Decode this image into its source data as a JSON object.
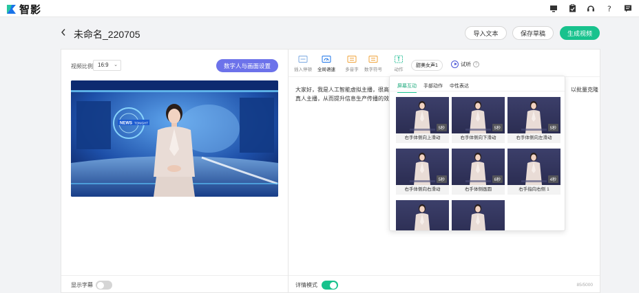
{
  "app": {
    "name": "智影"
  },
  "header": {
    "title": "未命名_220705",
    "import_label": "导入文本",
    "save_label": "保存草稿",
    "generate_label": "生成视频"
  },
  "left_panel": {
    "ratio_label": "视频比例",
    "ratio_value": "16:9",
    "avatar_settings_label": "数字人与画面设置",
    "preview_badge_main": "NEWS",
    "preview_badge_sub": "TONIGHT",
    "subtitle_label": "显示字幕",
    "subtitle_enabled": false
  },
  "toolbar": {
    "items": [
      {
        "label": "插入停顿"
      },
      {
        "label": "全局语速"
      },
      {
        "label": "多音字"
      },
      {
        "label": "数字符号"
      },
      {
        "label": "动作"
      }
    ],
    "voice_label": "甜美女声1",
    "listen_label": "试听",
    "help_icon": "?"
  },
  "script": {
    "line1_start": "大家好，我是人工智能虚拟主播，很高兴",
    "line1_end": "以批量克隆",
    "line2": "真人主播，从而提升信息生产传播的效率"
  },
  "action_popup": {
    "tabs": [
      {
        "label": "屏幕互动",
        "active": true
      },
      {
        "label": "手部动作",
        "active": false
      },
      {
        "label": "中性表达",
        "active": false
      }
    ],
    "cards": [
      {
        "caption": "右手体侧向上滑动",
        "duration": "5秒"
      },
      {
        "caption": "右手体侧向下滑动",
        "duration": "5秒"
      },
      {
        "caption": "右手体侧向左滑动",
        "duration": "5秒"
      },
      {
        "caption": "右手体侧向右滑动",
        "duration": "5秒"
      },
      {
        "caption": "右手体侧画圆",
        "duration": "6秒"
      },
      {
        "caption": "右手指向右侧 1",
        "duration": "4秒"
      },
      {
        "caption": "",
        "duration": ""
      },
      {
        "caption": "",
        "duration": ""
      }
    ]
  },
  "detail_mode": {
    "label": "详情模式",
    "enabled": true,
    "counter": "85/5000"
  },
  "colors": {
    "accent": "#18c28d",
    "avatar_button": "#6c72ea",
    "toggle_off": "#d5d5d5"
  }
}
